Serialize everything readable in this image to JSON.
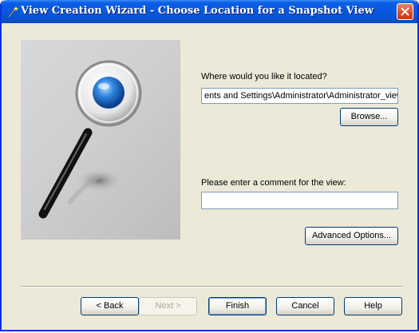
{
  "window": {
    "title": "View Creation Wizard - Choose Location for a Snapshot View"
  },
  "form": {
    "location_label": "Where would you like it located?",
    "location_value": "ents and Settings\\Administrator\\Administrator_view",
    "browse_label": "Browse...",
    "comment_label": "Please enter a comment for the view:",
    "comment_value": "",
    "advanced_label": "Advanced Options..."
  },
  "buttons": {
    "back": "< Back",
    "next": "Next >",
    "finish": "Finish",
    "cancel": "Cancel",
    "help": "Help"
  },
  "icons": {
    "title": "wand-icon",
    "close": "close-icon",
    "picture": "magnifying-glass-icon"
  },
  "colors": {
    "titlebar": "#0a5ee6",
    "dialog_bg": "#ece9d8",
    "close_button": "#d74a24",
    "lens_blue": "#2f86e0"
  }
}
